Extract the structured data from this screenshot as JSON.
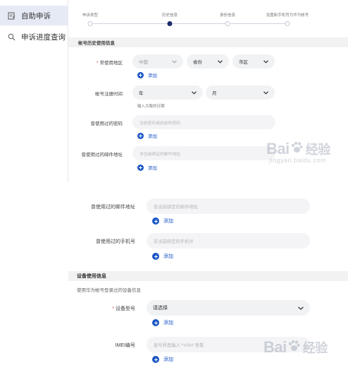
{
  "sidebar": {
    "items": [
      {
        "label": "自助申诉",
        "icon": "edit-document-icon",
        "active": true
      },
      {
        "label": "申诉进度查询",
        "icon": "search-icon",
        "active": false
      }
    ]
  },
  "steps": {
    "items": [
      "申诉类型",
      "历史信息",
      "身份信息",
      "设置新手机号为华为帐号"
    ],
    "active_index": 1
  },
  "section1": {
    "title": "帐号历史使用信息",
    "region": {
      "label": "常使用地区",
      "required_mark": "*",
      "country": "中国",
      "province": "省份",
      "city": "市区",
      "add": "添加"
    },
    "register_time": {
      "label": "帐号注册时间",
      "year": "年",
      "month": "月",
      "hint": "输入大致的日期"
    },
    "old_password": {
      "label": "曾使用过的密码",
      "placeholder": "当前密码或此前的密码",
      "add": "添加"
    },
    "old_email": {
      "label": "曾使用过的邮件地址",
      "placeholder": "非当前绑定的邮件地址",
      "add": "添加"
    }
  },
  "section2": {
    "old_email": {
      "label": "曾使用过的邮件地址",
      "placeholder": "非当前绑定的邮件地址",
      "add": "添加"
    },
    "old_phone": {
      "label": "曾使用过的手机号",
      "placeholder": "非当前绑定的手机号",
      "add": "添加"
    },
    "device_section_title": "设备使用信息",
    "device_section_subtitle": "使用华为帐号登录过的设备信息",
    "device_model": {
      "label": "设备型号",
      "required_mark": "*",
      "value": "请选择",
      "add": "添加"
    },
    "imei": {
      "label": "IMEI编号",
      "placeholder": "拨号界面输入\"*#06#\"查看",
      "add": "添加"
    }
  },
  "watermark": {
    "brand_left": "Bai",
    "brand_right": "经验",
    "url": "jingyan.baidu.com"
  },
  "colors": {
    "accent_blue": "#1a56c4",
    "active_step": "#1a2b6b",
    "required_red": "#e54545",
    "sidebar_active_bg": "#e6eaf5"
  }
}
